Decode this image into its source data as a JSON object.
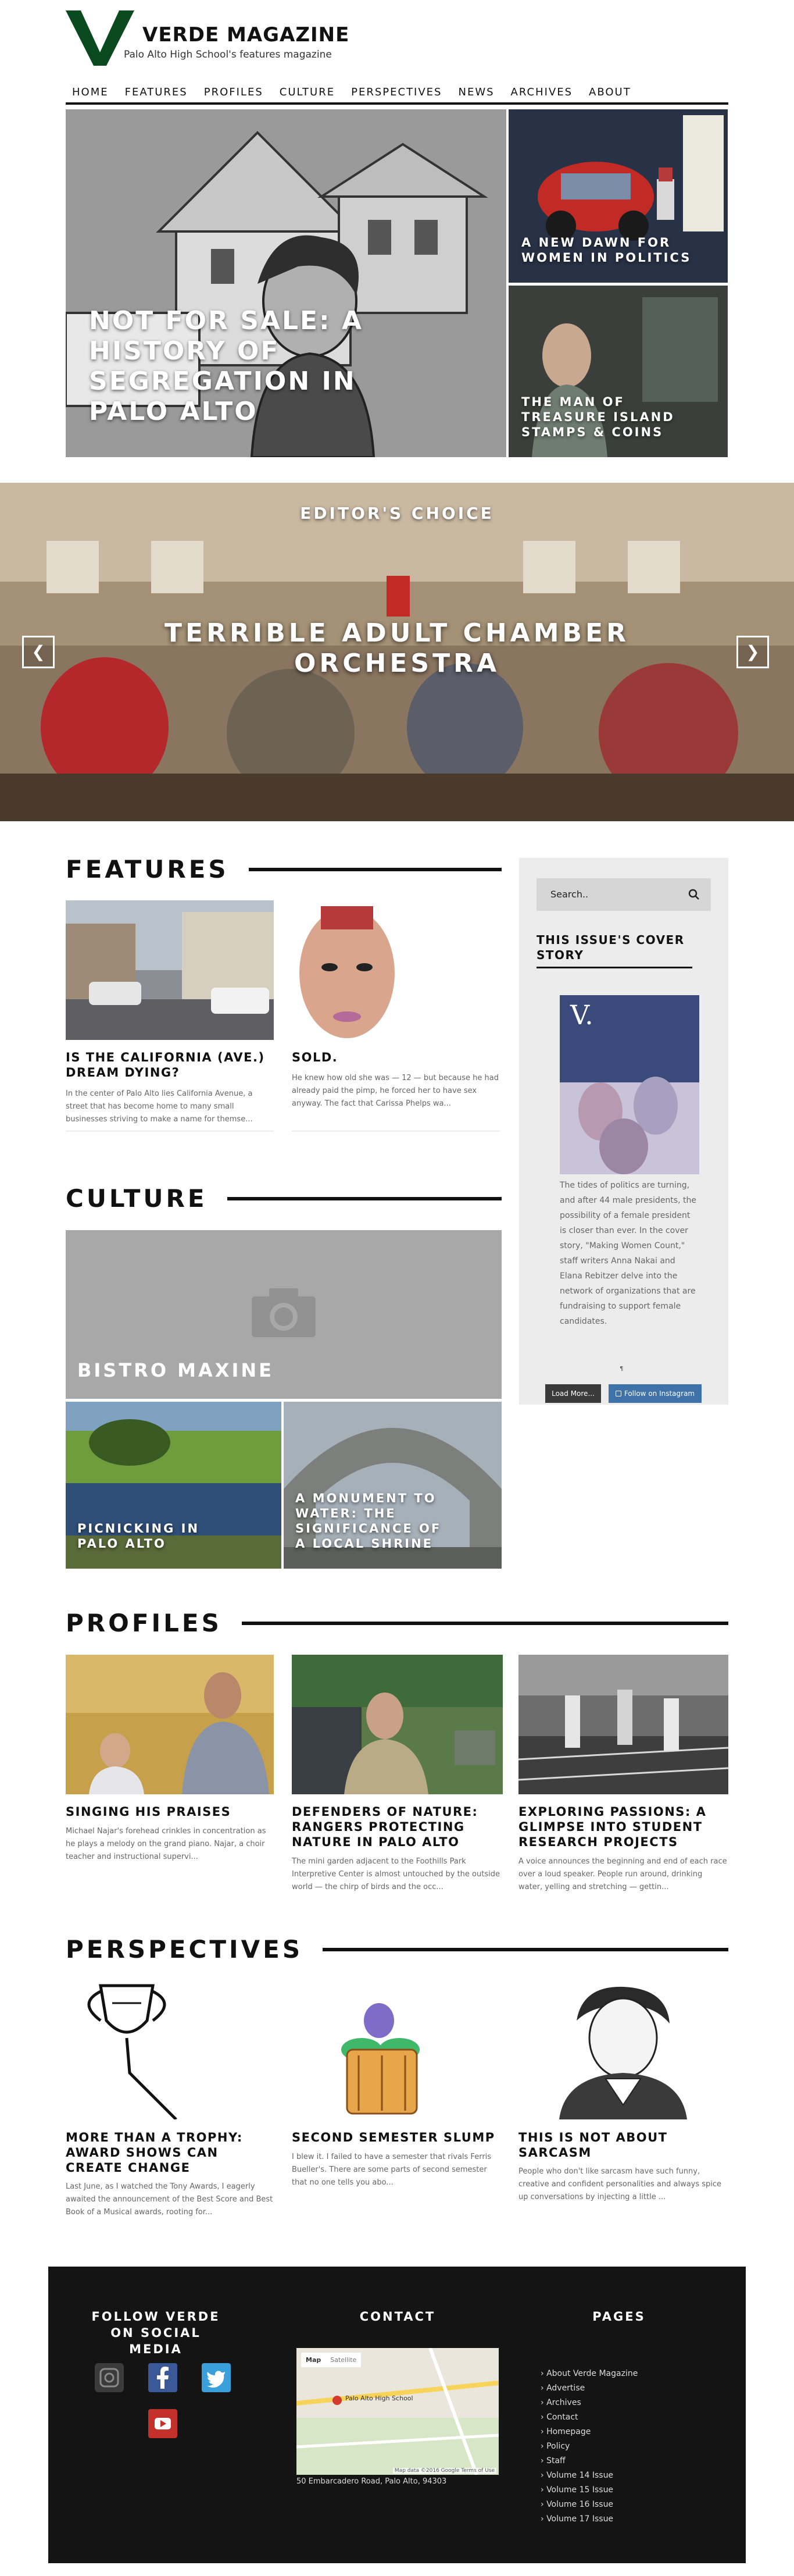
{
  "site": {
    "name": "VERDE MAGAZINE",
    "tagline": "Palo Alto High School's features magazine",
    "accent_color": "#0b4a1e"
  },
  "nav": [
    "HOME",
    "FEATURES",
    "PROFILES",
    "CULTURE",
    "PERSPECTIVES",
    "NEWS",
    "ARCHIVES",
    "ABOUT"
  ],
  "hero": {
    "main_title": "NOT FOR SALE: A HISTORY OF SEGREGATION IN PALO ALTO",
    "side": [
      {
        "title": "A NEW DAWN FOR WOMEN IN POLITICS"
      },
      {
        "title": "THE MAN OF TREASURE ISLAND STAMPS & COINS"
      }
    ]
  },
  "slider": {
    "tag": "EDITOR'S CHOICE",
    "title": "TERRIBLE ADULT CHAMBER ORCHESTRA",
    "prev_icon": "chevron-left-icon",
    "next_icon": "chevron-right-icon"
  },
  "features": {
    "heading": "FEATURES",
    "items": [
      {
        "title": "IS THE CALIFORNIA (AVE.) DREAM DYING?",
        "excerpt": "In the center of Palo Alto lies California Avenue, a street that has become home to many small businesses striving to make a name for themse..."
      },
      {
        "title": "SOLD.",
        "excerpt": "He knew how old she was — 12 — but because he had already paid the pimp, he forced her to have sex anyway. The fact that Carissa Phelps wa..."
      }
    ]
  },
  "culture": {
    "heading": "CULTURE",
    "items": [
      {
        "title": "BISTRO MAXINE"
      },
      {
        "title": "PICNICKING IN PALO ALTO"
      },
      {
        "title": "A MONUMENT TO WATER: THE SIGNIFICANCE OF A LOCAL SHRINE"
      }
    ]
  },
  "sidebar": {
    "search_placeholder": "Search..",
    "cover_heading": "THIS ISSUE'S COVER STORY",
    "cover_text": "The tides of politics are turning, and after 44 male presidents, the possibility of a female president is closer than ever. In the cover story, \"Making Women Count,\" staff writers Anna Nakai and Elana Rebitzer delve into the network of organizations that are fundraising to support female candidates.",
    "load_more": "Load More...",
    "follow_instagram": "Follow on Instagram"
  },
  "profiles": {
    "heading": "PROFILES",
    "items": [
      {
        "title": "SINGING HIS PRAISES",
        "excerpt": "Michael Najar's forehead crinkles in concentration as he plays a melody on the grand piano. Najar, a choir teacher and instructional supervi..."
      },
      {
        "title": "DEFENDERS OF NATURE: RANGERS PROTECTING NATURE IN PALO ALTO",
        "excerpt": "The mini garden adjacent to the Foothills Park Interpretive Center is almost untouched by the outside world — the chirp of birds and the occ..."
      },
      {
        "title": "EXPLORING PASSIONS: A GLIMPSE INTO STUDENT RESEARCH PROJECTS",
        "excerpt": "A voice announces the beginning and end of each race over a loud speaker. People run around, drinking water, yelling and stretching — gettin..."
      }
    ]
  },
  "perspectives": {
    "heading": "PERSPECTIVES",
    "items": [
      {
        "title": "MORE THAN A TROPHY: AWARD SHOWS CAN CREATE CHANGE",
        "excerpt": "Last June, as I watched the Tony Awards, I eagerly awaited the announcement of the Best Score and Best Book of a Musical awards, rooting for..."
      },
      {
        "title": "SECOND SEMESTER SLUMP",
        "excerpt": "I blew it. I failed to have a semester that rivals Ferris Bueller's. There are some parts of second semester that no one tells you abo..."
      },
      {
        "title": "THIS IS NOT ABOUT SARCASM",
        "excerpt": "People who don't like sarcasm have such funny, creative and confident personalities and always spice up conversations by injecting a little ..."
      }
    ]
  },
  "footer": {
    "social_heading": "FOLLOW VERDE ON SOCIAL MEDIA",
    "contact_heading": "CONTACT",
    "pages_heading": "PAGES",
    "map_tabs": [
      "Map",
      "Satellite"
    ],
    "map_label": "Palo Alto High School",
    "map_credit": "Map data ©2016 Google   Terms of Use",
    "address": "50 Embarcadero Road, Palo Alto, 94303",
    "social_icons": [
      "instagram-icon",
      "facebook-icon",
      "twitter-icon",
      "youtube-icon"
    ],
    "pages": [
      "About Verde Magazine",
      "Advertise",
      "Archives",
      "Contact",
      "Homepage",
      "Policy",
      "Staff",
      "Volume 14 Issue",
      "Volume 15 Issue",
      "Volume 16 Issue",
      "Volume 17 Issue"
    ]
  }
}
